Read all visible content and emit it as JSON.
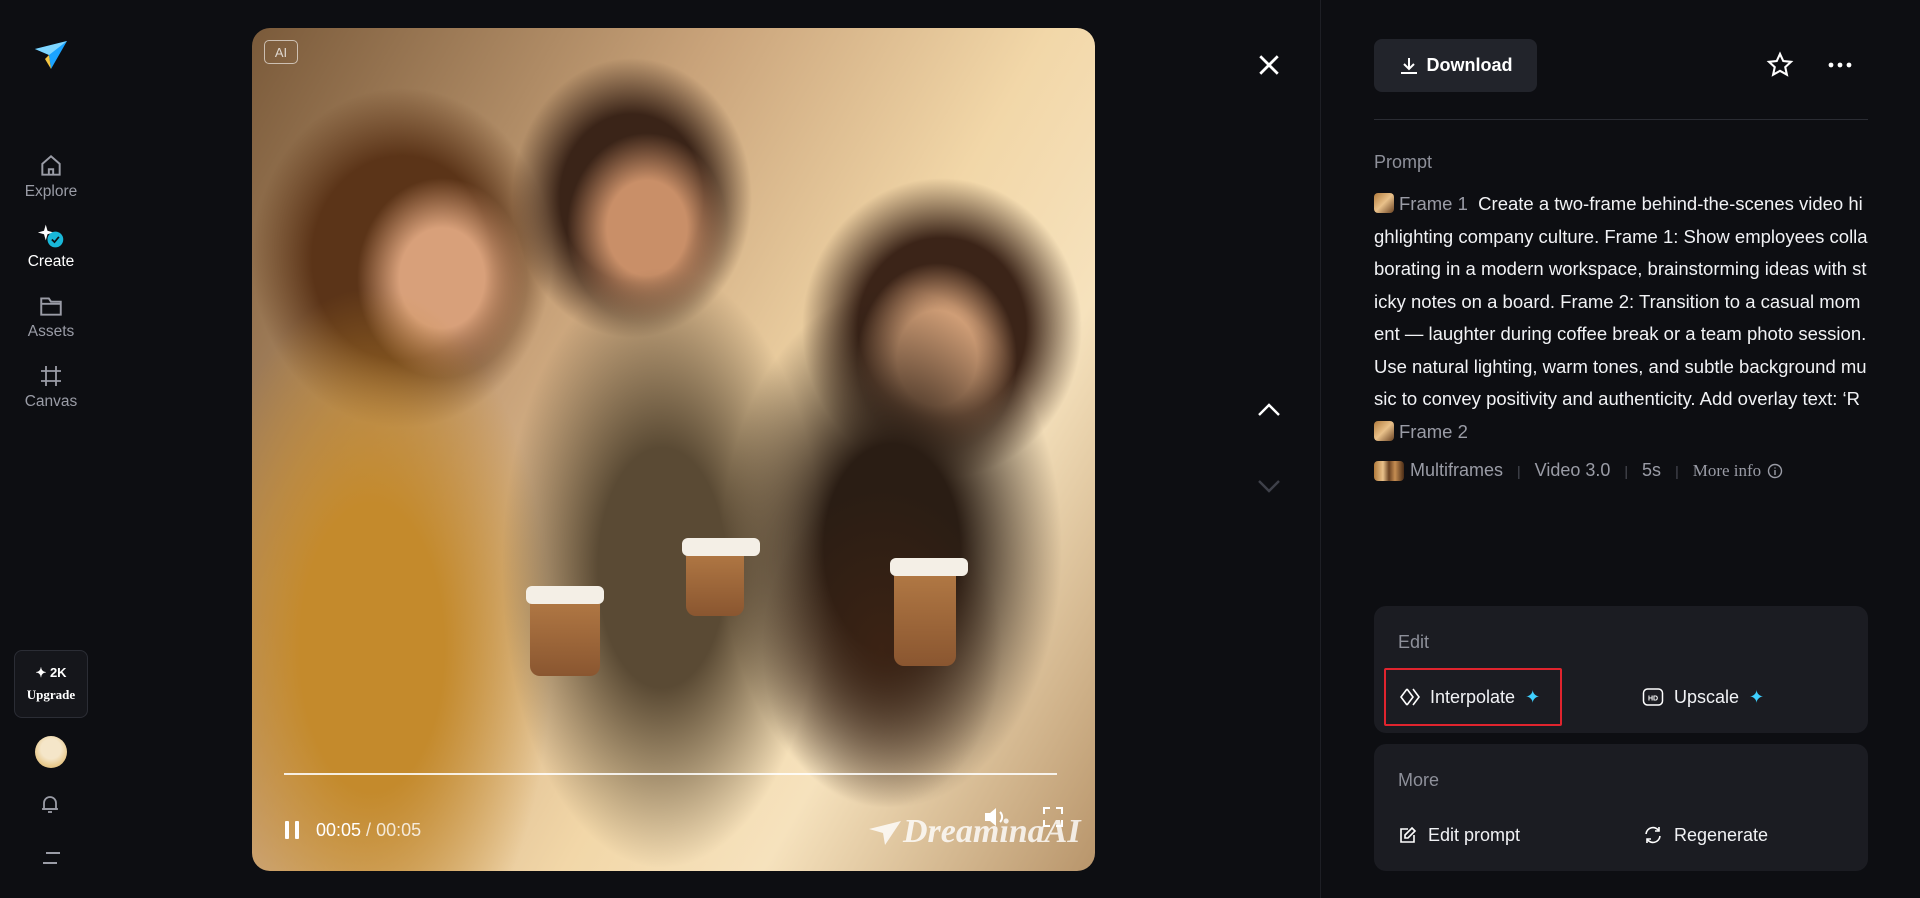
{
  "sidebar": {
    "items": [
      {
        "label": "Explore",
        "icon": "home-icon"
      },
      {
        "label": "Create",
        "icon": "create-icon"
      },
      {
        "label": "Assets",
        "icon": "folder-icon"
      },
      {
        "label": "Canvas",
        "icon": "canvas-icon"
      }
    ],
    "upgrade": {
      "credits": "✦ 2K",
      "label": "Upgrade"
    }
  },
  "video": {
    "ai_badge": "AI",
    "time_current": "00:05",
    "time_sep": " / ",
    "time_total": "00:05",
    "progress": 1.0,
    "watermark": "DreaminaAI"
  },
  "panel": {
    "download_label": "Download",
    "prompt_heading": "Prompt",
    "frame1_label": "Frame 1",
    "prompt_body": "Create a two-frame behind-the-scenes video highlighting company culture. Frame 1: Show employees collaborating in a modern workspace, brainstorming ideas with sticky notes on a board. Frame 2: Transition to a casual moment — laughter during coffee break or a team photo session. Use natural lighting, warm tones, and subtle background music to convey positivity and authenticity. Add overlay text: ‘R",
    "frame2_label": "Frame 2",
    "meta": {
      "type": "Multiframes",
      "model": "Video 3.0",
      "duration": "5s",
      "more_info": "More info"
    },
    "edit": {
      "title": "Edit",
      "interpolate": "Interpolate",
      "upscale": "Upscale"
    },
    "more": {
      "title": "More",
      "edit_prompt": "Edit prompt",
      "regenerate": "Regenerate"
    }
  },
  "colors": {
    "background": "#0d0e12",
    "accent": "#3fd0ff",
    "highlight_border": "#e0242e",
    "card": "#1b1c22"
  }
}
